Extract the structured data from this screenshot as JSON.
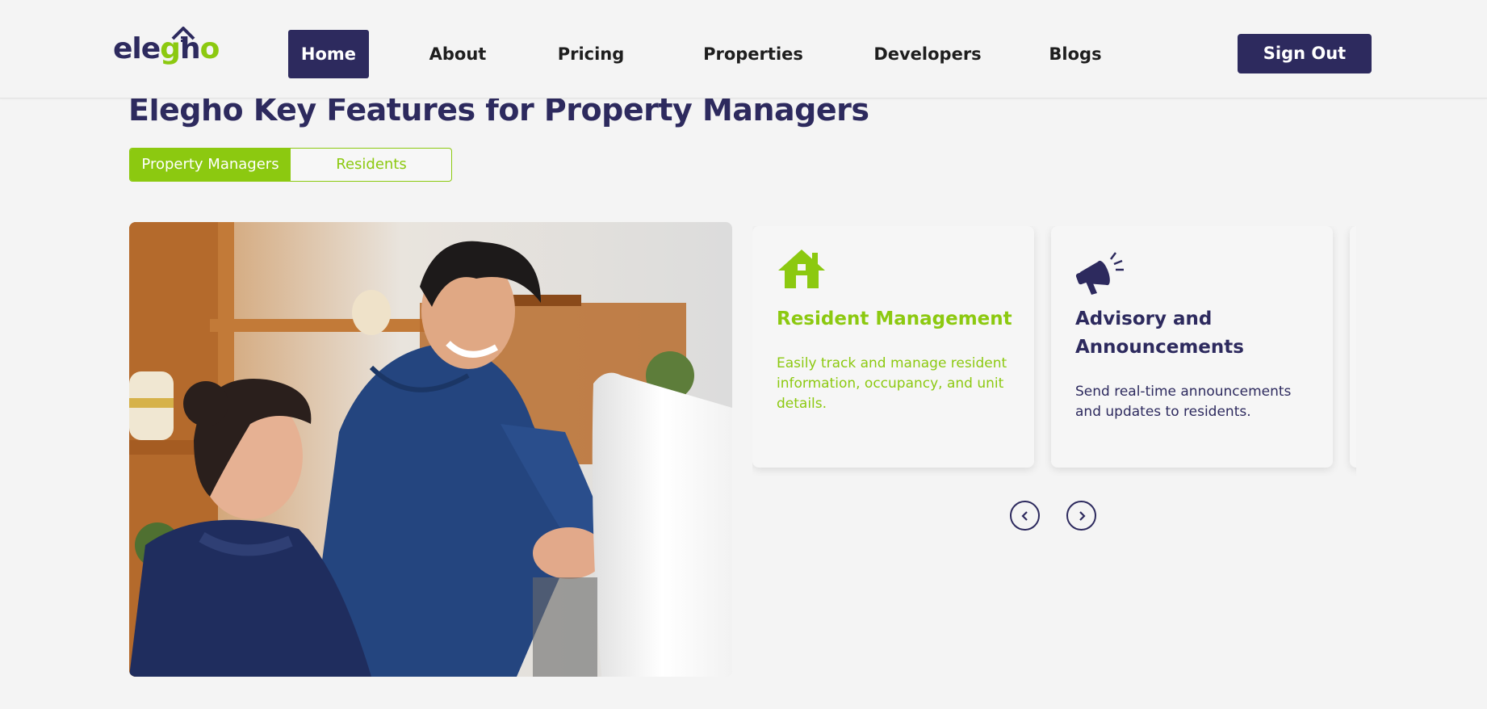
{
  "brand": {
    "logo_prefix": "ele",
    "logo_g": "g",
    "logo_h": "h",
    "logo_o": "o"
  },
  "nav": {
    "items": [
      {
        "label": "Home",
        "active": true
      },
      {
        "label": "About"
      },
      {
        "label": "Pricing"
      },
      {
        "label": "Properties"
      },
      {
        "label": "Developers"
      },
      {
        "label": "Blogs"
      }
    ],
    "signout_label": "Sign Out"
  },
  "main": {
    "title": "Elegho Key Features for Property Managers",
    "tabs": [
      {
        "label": "Property Managers",
        "active": true
      },
      {
        "label": "Residents"
      }
    ],
    "cards": [
      {
        "icon": "house-icon",
        "title": "Resident Management",
        "description": "Easily track and manage resident information, occupancy, and unit details."
      },
      {
        "icon": "megaphone-icon",
        "title": "Advisory and Announcements",
        "description": "Send real-time announcements and updates to residents."
      }
    ],
    "prev_icon": "chevron-left-icon",
    "next_icon": "chevron-right-icon"
  },
  "colors": {
    "navy": "#2d2a5e",
    "green": "#8cc910",
    "background": "#f4f4f4"
  }
}
